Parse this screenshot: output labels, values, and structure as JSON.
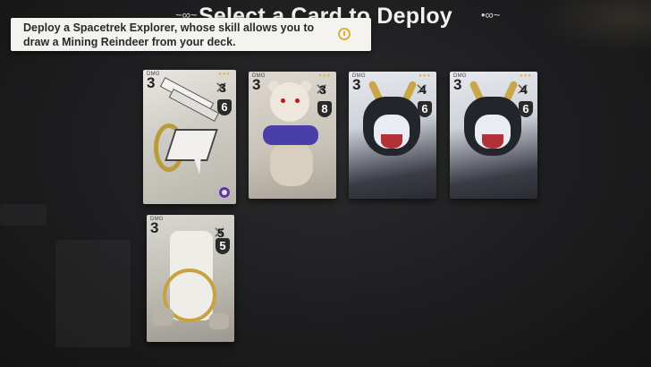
{
  "title": "Select a Card to Deploy",
  "hint": {
    "text": "Deploy a Spacetrek Explorer, whose skill allows you to draw a Mining Reindeer from your deck."
  },
  "cards": [
    {
      "dmg_label": "DMG",
      "dmg": "3",
      "atk": "3",
      "hp": "6",
      "pips": "●●●",
      "art": "mech",
      "selected": true
    },
    {
      "dmg_label": "DMG",
      "dmg": "3",
      "atk": "3",
      "hp": "8",
      "pips": "●●●",
      "art": "bear"
    },
    {
      "dmg_label": "DMG",
      "dmg": "3",
      "atk": "4",
      "hp": "6",
      "pips": "●●●",
      "art": "wolf"
    },
    {
      "dmg_label": "DMG",
      "dmg": "3",
      "atk": "4",
      "hp": "6",
      "pips": "●●●",
      "art": "wolf"
    },
    {
      "dmg_label": "DMG",
      "dmg": "3",
      "atk": "5",
      "hp": "5",
      "pips": "",
      "art": "knight"
    }
  ],
  "colors": {
    "accent": "#e3b540",
    "hint_bg": "#f4f3ef"
  },
  "icons": {
    "title_flourish": "swirl-icon",
    "hint": "clock-icon",
    "attack": "crossed-swords-icon",
    "trait": "trait-icon"
  }
}
